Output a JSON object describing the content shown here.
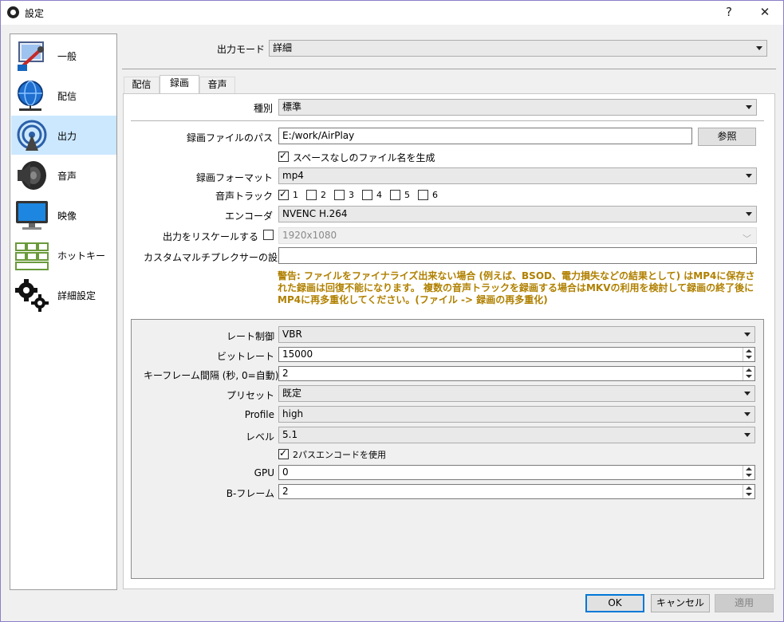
{
  "window": {
    "title": "設定",
    "help_btn": "?",
    "close_btn": "✕"
  },
  "sidebar": {
    "items": [
      {
        "label": "一般",
        "icon": "general-icon"
      },
      {
        "label": "配信",
        "icon": "stream-globe-icon"
      },
      {
        "label": "出力",
        "icon": "output-broadcast-icon",
        "selected": true
      },
      {
        "label": "音声",
        "icon": "speaker-icon"
      },
      {
        "label": "映像",
        "icon": "monitor-icon"
      },
      {
        "label": "ホットキー",
        "icon": "keyboard-icon"
      },
      {
        "label": "詳細設定",
        "icon": "gears-icon"
      }
    ]
  },
  "output_mode": {
    "label": "出力モード",
    "value": "詳細"
  },
  "tabs": [
    {
      "label": "配信"
    },
    {
      "label": "録画",
      "active": true
    },
    {
      "label": "音声"
    }
  ],
  "recording": {
    "type_label": "種別",
    "type_value": "標準",
    "path_label": "録画ファイルのパス",
    "path_value": "E:/work/AirPlay",
    "browse_btn": "参照",
    "nospace_label": "スペースなしのファイル名を生成",
    "nospace_checked": true,
    "format_label": "録画フォーマット",
    "format_value": "mp4",
    "tracks_label": "音声トラック",
    "tracks": [
      {
        "label": "1",
        "checked": true
      },
      {
        "label": "2",
        "checked": false
      },
      {
        "label": "3",
        "checked": false
      },
      {
        "label": "4",
        "checked": false
      },
      {
        "label": "5",
        "checked": false
      },
      {
        "label": "6",
        "checked": false
      }
    ],
    "encoder_label": "エンコーダ",
    "encoder_value": "NVENC H.264",
    "rescale_label": "出力をリスケールする",
    "rescale_checked": false,
    "rescale_value": "1920x1080",
    "muxer_label": "カスタムマルチプレクサーの設定",
    "muxer_value": "",
    "warning": "警告: ファイルをファイナライズ出来ない場合 (例えば、BSOD、電力損失などの結果として) はMP4に保存された録画は回復不能になります。 複数の音声トラックを録画する場合はMKVの利用を検討して録画の終了後にMP4に再多重化してください。(ファイル -> 録画の再多重化)"
  },
  "encoder_settings": {
    "rate_label": "レート制御",
    "rate_value": "VBR",
    "bitrate_label": "ビットレート",
    "bitrate_value": "15000",
    "keyframe_label": "キーフレーム間隔 (秒, 0=自動)",
    "keyframe_value": "2",
    "preset_label": "プリセット",
    "preset_value": "既定",
    "profile_label": "Profile",
    "profile_value": "high",
    "level_label": "レベル",
    "level_value": "5.1",
    "twopass_label": "2パスエンコードを使用",
    "twopass_checked": true,
    "gpu_label": "GPU",
    "gpu_value": "0",
    "bframes_label": "B-フレーム",
    "bframes_value": "2"
  },
  "buttons": {
    "ok": "OK",
    "cancel": "キャンセル",
    "apply": "適用"
  },
  "colors": {
    "selection": "#cce8ff",
    "warning_text": "#b08000",
    "accent": "#0078d7"
  }
}
